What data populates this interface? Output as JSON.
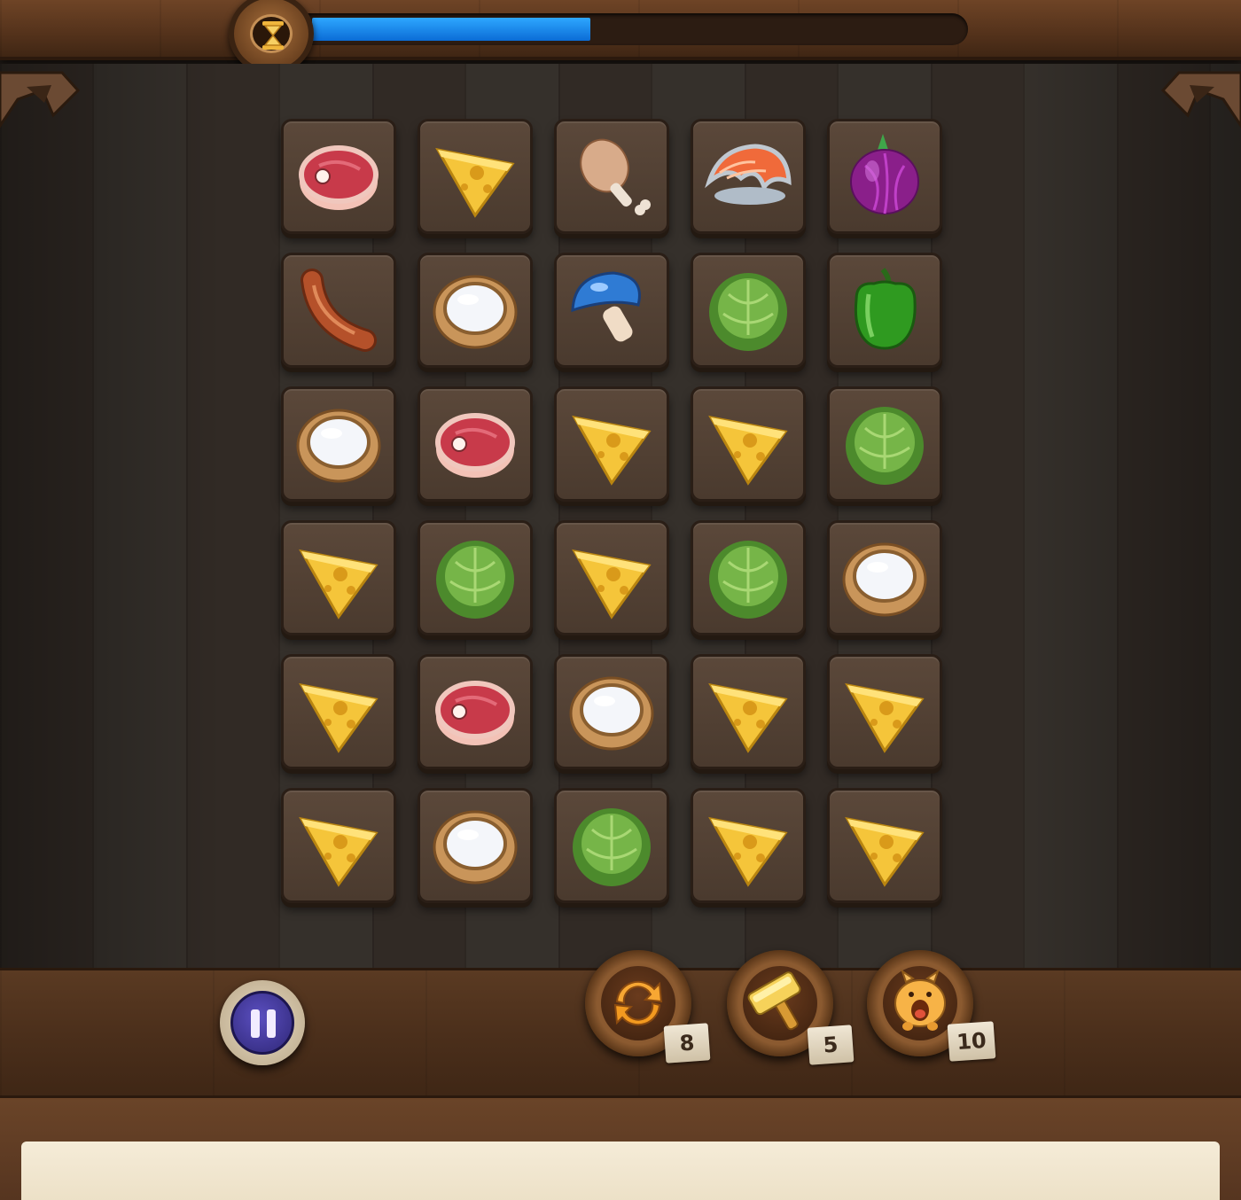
{
  "timer": {
    "progress": 0.43,
    "icon": "hourglass-icon"
  },
  "board": {
    "rows": 6,
    "cols": 5,
    "tiles": [
      [
        "steak",
        "cheese",
        "drumstick",
        "salmon",
        "onion"
      ],
      [
        "sausage",
        "milk",
        "mushroom",
        "cabbage",
        "pepper"
      ],
      [
        "milk",
        "steak",
        "cheese",
        "cheese",
        "cabbage"
      ],
      [
        "cheese",
        "cabbage",
        "cheese",
        "cabbage",
        "milk"
      ],
      [
        "cheese",
        "steak",
        "milk",
        "cheese",
        "cheese"
      ],
      [
        "cheese",
        "milk",
        "cabbage",
        "cheese",
        "cheese"
      ]
    ]
  },
  "controls": {
    "pause_icon": "pause-icon"
  },
  "boosters": [
    {
      "name": "shuffle",
      "icon": "shuffle-icon",
      "count": "8"
    },
    {
      "name": "hammer",
      "icon": "hammer-icon",
      "count": "5"
    },
    {
      "name": "pig",
      "icon": "pig-icon",
      "count": "10"
    }
  ],
  "colors": {
    "timer_fill": "#1e8cf0",
    "wood": "#54321b",
    "board": "#302924"
  }
}
